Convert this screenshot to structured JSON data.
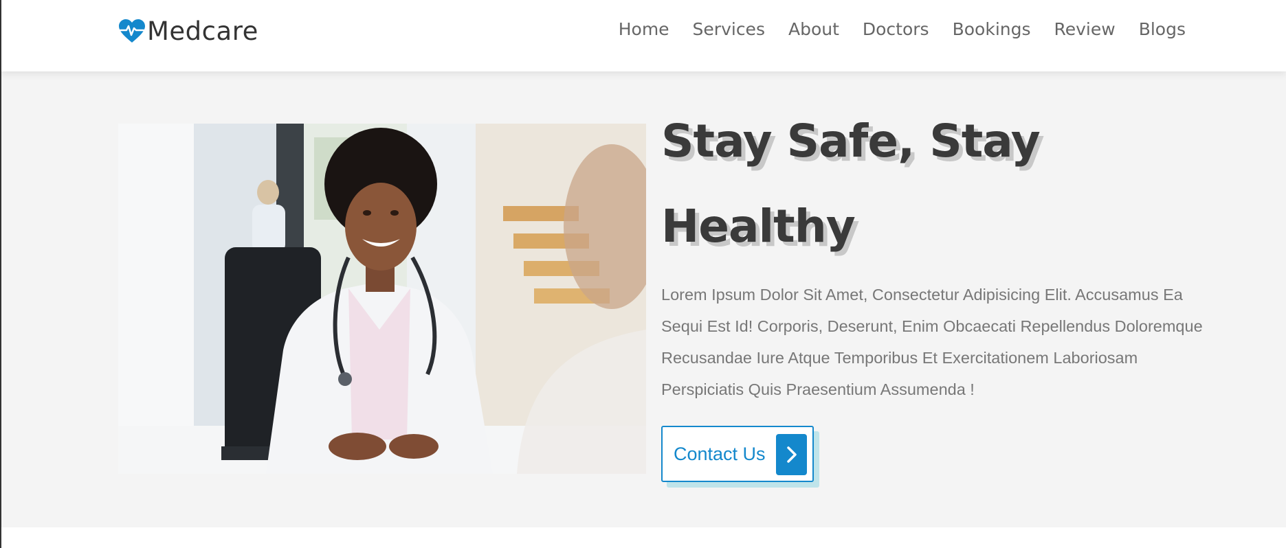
{
  "brand": {
    "name": "Medcare",
    "logo_icon": "heart-pulse-icon",
    "accent_color": "#1488cc"
  },
  "nav": {
    "items": [
      {
        "label": "Home"
      },
      {
        "label": "Services"
      },
      {
        "label": "About"
      },
      {
        "label": "Doctors"
      },
      {
        "label": "Bookings"
      },
      {
        "label": "Review"
      },
      {
        "label": "Blogs"
      }
    ]
  },
  "hero": {
    "title_line1": "Stay Safe, Stay",
    "title_line2": "Healthy",
    "description": "Lorem Ipsum Dolor Sit Amet, Consectetur Adipisicing Elit. Accusamus Ea Sequi Est Id! Corporis, Deserunt, Enim Obcaecati Repellendus Doloremque Recusandae Iure Atque Temporibus Et Exercitationem Laboriosam Perspiciatis Quis Praesentium Assumenda !",
    "cta_label": "Contact Us",
    "cta_icon": "chevron-right-icon",
    "image_subject": "smiling-doctor-photo"
  }
}
